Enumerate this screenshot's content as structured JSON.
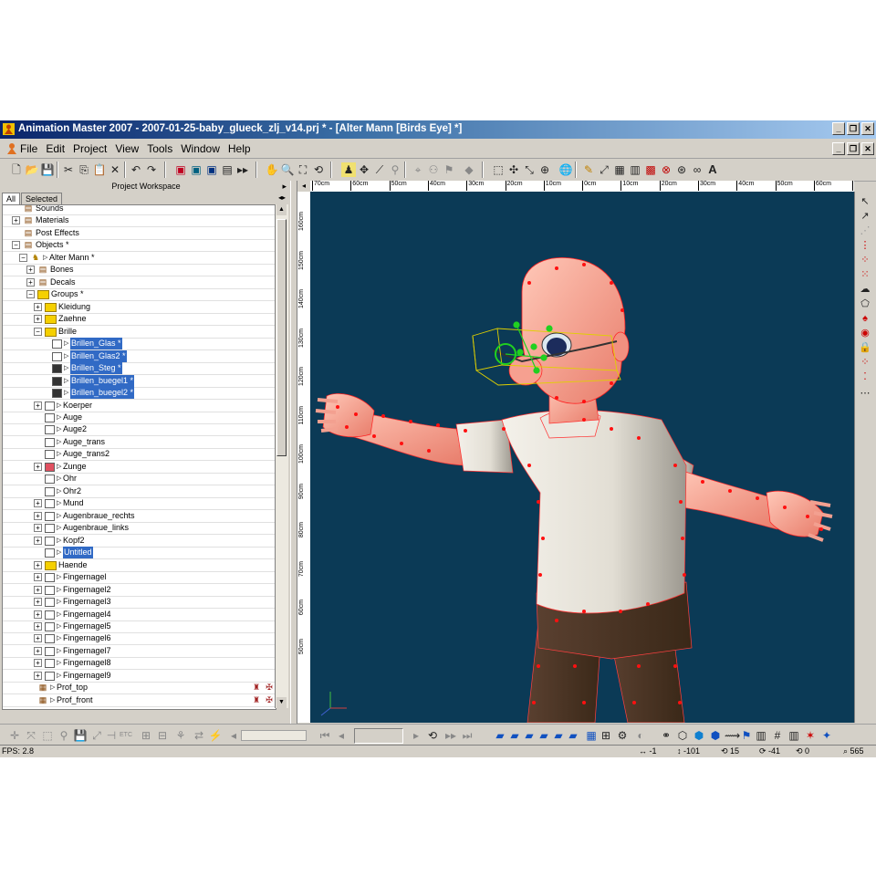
{
  "window": {
    "title": "Animation Master 2007 - 2007-01-25-baby_glueck_zlj_v14.prj * - [Alter Mann [Birds Eye] *]"
  },
  "menu": [
    "File",
    "Edit",
    "Project",
    "View",
    "Tools",
    "Window",
    "Help"
  ],
  "workspace": {
    "title": "Project Workspace",
    "tabs": [
      "All",
      "Selected"
    ]
  },
  "tree": [
    {
      "label": "Sounds",
      "indent": 0,
      "exp": "",
      "icon": "sounds-icon"
    },
    {
      "label": "Materials",
      "indent": 0,
      "exp": "+",
      "icon": "materials-icon"
    },
    {
      "label": "Post Effects",
      "indent": 0,
      "exp": "",
      "icon": "post-effects-icon"
    },
    {
      "label": "Objects *",
      "indent": 0,
      "exp": "-",
      "icon": "objects-icon"
    },
    {
      "label": "Alter Mann *",
      "indent": 1,
      "exp": "-",
      "icon": "model-icon",
      "tri": true
    },
    {
      "label": "Bones",
      "indent": 2,
      "exp": "+",
      "icon": "bones-icon"
    },
    {
      "label": "Decals",
      "indent": 2,
      "exp": "+",
      "icon": "decals-icon"
    },
    {
      "label": "Groups *",
      "indent": 2,
      "exp": "-",
      "icon": "folder-icon"
    },
    {
      "label": "Kleidung",
      "indent": 3,
      "exp": "+",
      "icon": "folder-icon"
    },
    {
      "label": "Zaehne",
      "indent": 3,
      "exp": "+",
      "icon": "folder-icon"
    },
    {
      "label": "Brille",
      "indent": 3,
      "exp": "-",
      "icon": "folder-icon"
    },
    {
      "label": "Brillen_Glas *",
      "indent": 4,
      "exp": "",
      "swatch": "#ffffff",
      "tri": true,
      "selected": true
    },
    {
      "label": "Brillen_Glas2 *",
      "indent": 4,
      "exp": "",
      "swatch": "#ffffff",
      "tri": true,
      "selected": true
    },
    {
      "label": "Brillen_Steg *",
      "indent": 4,
      "exp": "",
      "swatch": "#333333",
      "tri": true,
      "selected": true
    },
    {
      "label": "Brillen_buegel1 *",
      "indent": 4,
      "exp": "",
      "swatch": "#333333",
      "tri": true,
      "selected": true
    },
    {
      "label": "Brillen_buegel2 *",
      "indent": 4,
      "exp": "",
      "swatch": "#333333",
      "tri": true,
      "selected": true
    },
    {
      "label": "Koerper",
      "indent": 3,
      "exp": "+",
      "swatch": "#ffffff",
      "tri": true
    },
    {
      "label": "Auge",
      "indent": 3,
      "exp": "",
      "swatch": "#ffffff",
      "tri": true
    },
    {
      "label": "Auge2",
      "indent": 3,
      "exp": "",
      "swatch": "#ffffff",
      "tri": true
    },
    {
      "label": "Auge_trans",
      "indent": 3,
      "exp": "",
      "swatch": "#ffffff",
      "tri": true
    },
    {
      "label": "Auge_trans2",
      "indent": 3,
      "exp": "",
      "swatch": "#ffffff",
      "tri": true
    },
    {
      "label": "Zunge",
      "indent": 3,
      "exp": "+",
      "swatch": "#e05060",
      "tri": true
    },
    {
      "label": "Ohr",
      "indent": 3,
      "exp": "",
      "swatch": "#ffffff",
      "tri": true
    },
    {
      "label": "Ohr2",
      "indent": 3,
      "exp": "",
      "swatch": "#ffffff",
      "tri": true
    },
    {
      "label": "Mund",
      "indent": 3,
      "exp": "+",
      "swatch": "#ffffff",
      "tri": true
    },
    {
      "label": "Augenbraue_rechts",
      "indent": 3,
      "exp": "+",
      "swatch": "#ffffff",
      "tri": true
    },
    {
      "label": "Augenbraue_links",
      "indent": 3,
      "exp": "+",
      "swatch": "#ffffff",
      "tri": true
    },
    {
      "label": "Kopf2",
      "indent": 3,
      "exp": "+",
      "swatch": "#ffffff",
      "tri": true
    },
    {
      "label": "Untitled",
      "indent": 3,
      "exp": "",
      "swatch": "#ffffff",
      "tri": true,
      "selected": true
    },
    {
      "label": "Haende",
      "indent": 3,
      "exp": "+",
      "icon": "folder-icon"
    },
    {
      "label": "Fingernagel",
      "indent": 3,
      "exp": "+",
      "swatch": "#ffffff",
      "tri": true
    },
    {
      "label": "Fingernagel2",
      "indent": 3,
      "exp": "+",
      "swatch": "#ffffff",
      "tri": true
    },
    {
      "label": "Fingernagel3",
      "indent": 3,
      "exp": "+",
      "swatch": "#ffffff",
      "tri": true
    },
    {
      "label": "Fingernagel4",
      "indent": 3,
      "exp": "+",
      "swatch": "#ffffff",
      "tri": true
    },
    {
      "label": "Fingernagel5",
      "indent": 3,
      "exp": "+",
      "swatch": "#ffffff",
      "tri": true
    },
    {
      "label": "Fingernagel6",
      "indent": 3,
      "exp": "+",
      "swatch": "#ffffff",
      "tri": true
    },
    {
      "label": "Fingernagel7",
      "indent": 3,
      "exp": "+",
      "swatch": "#ffffff",
      "tri": true
    },
    {
      "label": "Fingernagel8",
      "indent": 3,
      "exp": "+",
      "swatch": "#ffffff",
      "tri": true
    },
    {
      "label": "Fingernagel9",
      "indent": 3,
      "exp": "+",
      "swatch": "#ffffff",
      "tri": true
    },
    {
      "label": "Prof_top",
      "indent": 2,
      "exp": "",
      "icon": "pose-icon",
      "tri": true
    },
    {
      "label": "Prof_front",
      "indent": 2,
      "exp": "",
      "icon": "pose-icon",
      "tri": true
    }
  ],
  "ruler": {
    "top": [
      "70cm",
      "60cm",
      "50cm",
      "40cm",
      "30cm",
      "20cm",
      "10cm",
      "0cm",
      "10cm",
      "20cm",
      "30cm",
      "40cm",
      "50cm",
      "60cm",
      "70cm"
    ],
    "left": [
      "160cm",
      "150cm",
      "140cm",
      "130cm",
      "120cm",
      "110cm",
      "100cm",
      "90cm",
      "80cm",
      "70cm",
      "60cm",
      "50cm"
    ]
  },
  "status": {
    "fps": "FPS: 2.8",
    "readouts": [
      "-1",
      "-101",
      "15",
      "-41",
      "0",
      "565"
    ]
  },
  "colors": {
    "viewport_bg": "#0b3a56",
    "selection": "#316ac5",
    "mesh_spline": "#ff2020",
    "bone_select": "#20d020"
  }
}
